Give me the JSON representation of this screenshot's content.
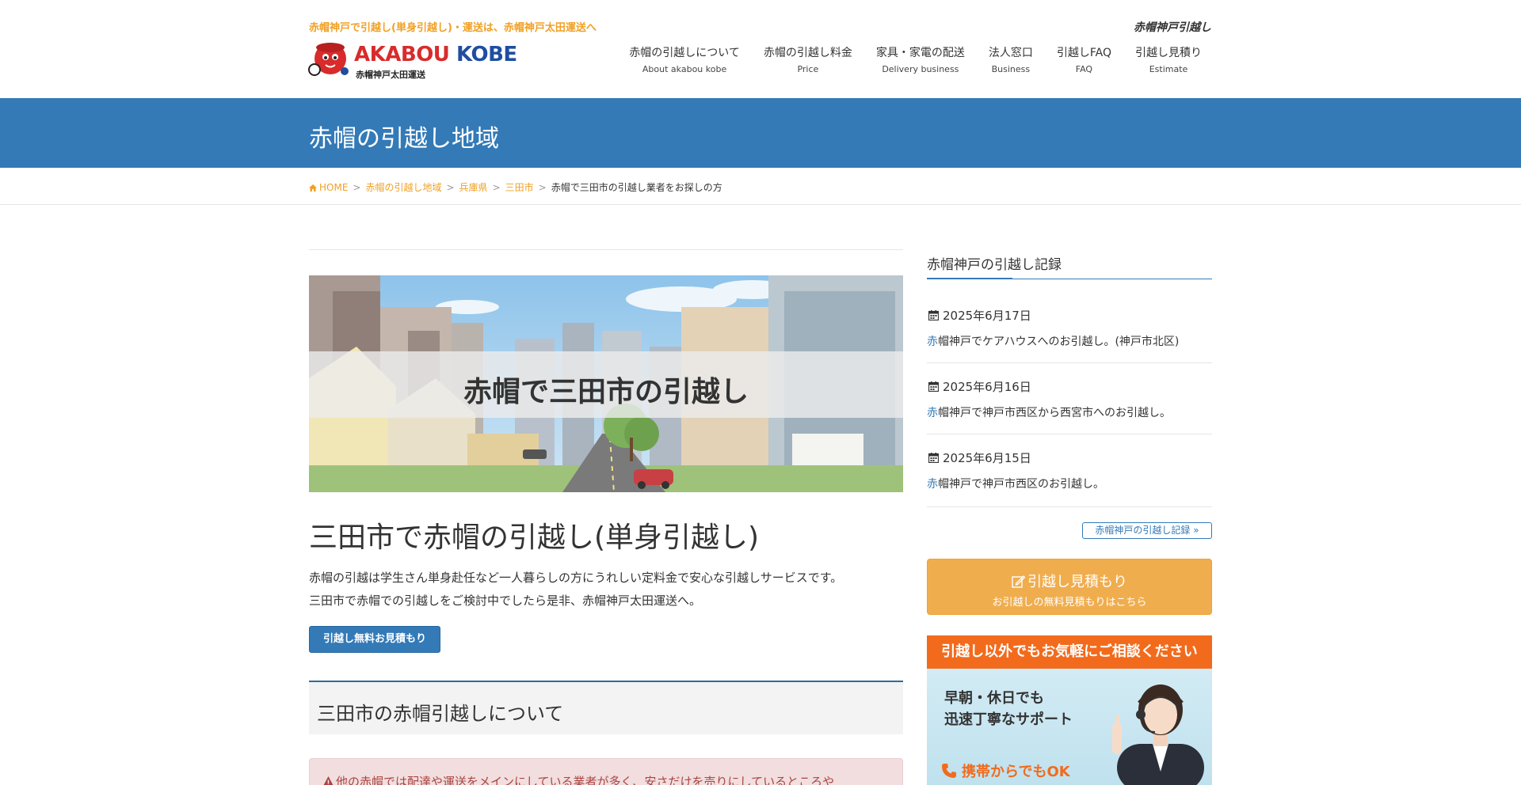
{
  "header": {
    "tagline": "赤帽神戸で引越し(単身引越し)・運送は、赤帽神戸太田運送へ",
    "top_right": "赤帽神戸引越し",
    "logo": {
      "word_red": "AKABOU",
      "word_blue": "KOBE",
      "sub": "赤帽神戸太田運送"
    },
    "nav": [
      {
        "jp": "赤帽の引越しについて",
        "en": "About akabou kobe"
      },
      {
        "jp": "赤帽の引越し料金",
        "en": "Price"
      },
      {
        "jp": "家具・家電の配送",
        "en": "Delivery business"
      },
      {
        "jp": "法人窓口",
        "en": "Business"
      },
      {
        "jp": "引越しFAQ",
        "en": "FAQ"
      },
      {
        "jp": "引越し見積り",
        "en": "Estimate"
      }
    ]
  },
  "banner": {
    "title": "赤帽の引越し地域"
  },
  "breadcrumb": {
    "home": "HOME",
    "sep": ">",
    "items": [
      "赤帽の引越し地域",
      "兵庫県",
      "三田市"
    ],
    "current": "赤帽で三田市の引越し業者をお探しの方"
  },
  "main": {
    "hero_title": "赤帽で三田市の引越し",
    "section_title": "三田市で赤帽の引越し(単身引越し)",
    "intro_line1": "赤帽の引越は学生さん単身赴任など一人暮らしの方にうれしい定料金で安心な引越しサービスです。",
    "intro_line2": "三田市で赤帽での引越しをご検討中でしたら是非、赤帽神戸太田運送へ。",
    "quote_button": "引越し無料お見積もり",
    "h2": "三田市の赤帽引越しについて",
    "alert": "他の赤帽では配達や運送をメインにしている業者が多く、安さだけを売りにしているところや"
  },
  "sidebar": {
    "title": "赤帽神戸の引越し記録",
    "records": [
      {
        "date": "2025年6月17日",
        "title_first": "赤",
        "title_rest": "帽神戸でケアハウスへのお引越し。(神戸市北区)"
      },
      {
        "date": "2025年6月16日",
        "title_first": "赤",
        "title_rest": "帽神戸で神戸市西区から西宮市へのお引越し。"
      },
      {
        "date": "2025年6月15日",
        "title_first": "赤",
        "title_rest": "帽神戸で神戸市西区のお引越し。"
      }
    ],
    "records_button": "赤帽神戸の引越し記録 »",
    "estimate": {
      "line1": "引越し見積もり",
      "line2": "お引越しの無料見積もりはこちら"
    },
    "support": {
      "head": "引越し以外でもお気軽にご相談ください",
      "line1": "早朝・休日でも",
      "line2": "迅速丁寧なサポート",
      "phone": "携帯からでもOK"
    }
  },
  "colors": {
    "accent_orange": "#f0a024",
    "brand_blue": "#337ab7",
    "estimate_orange": "#f0ad4e",
    "support_orange": "#f26b1d"
  }
}
